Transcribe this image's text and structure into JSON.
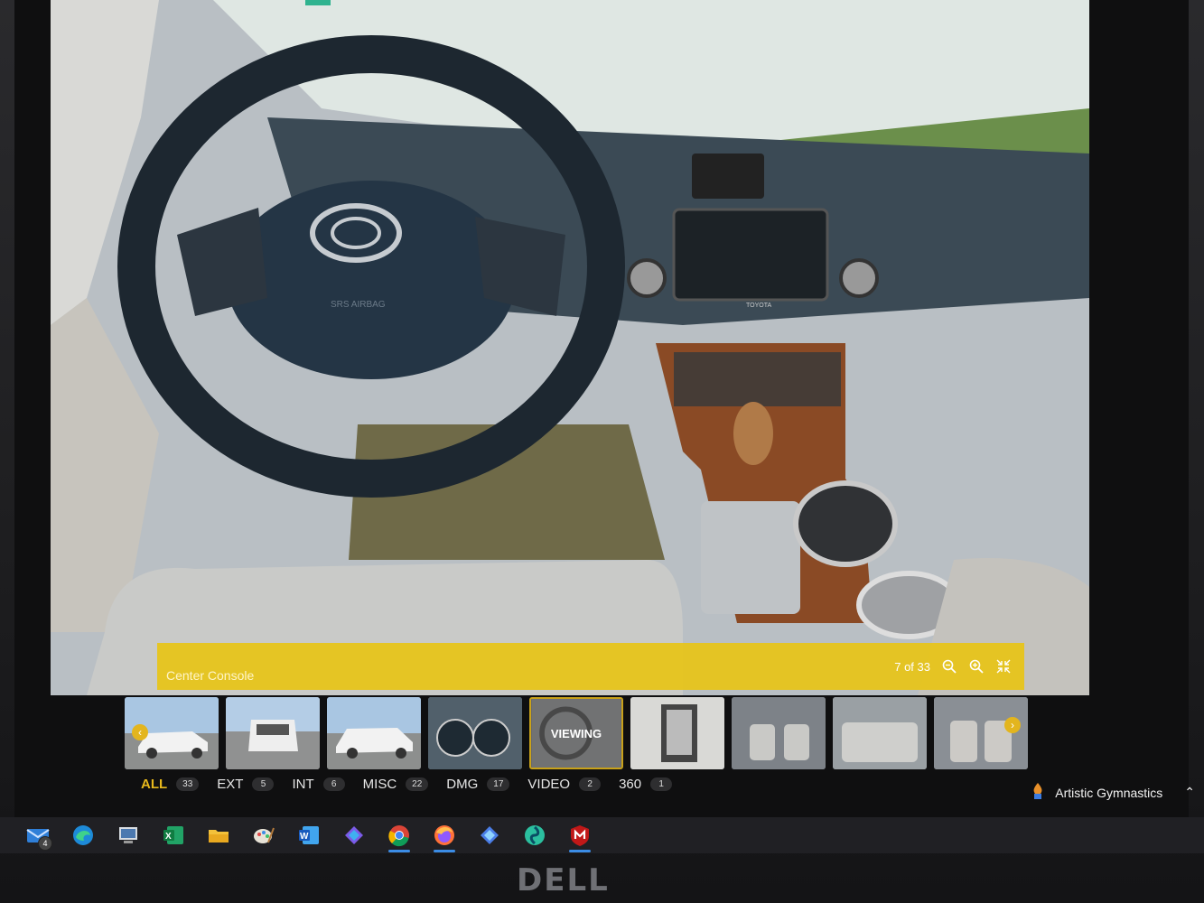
{
  "viewer": {
    "caption": "Center Console",
    "counter": "7 of 33",
    "controls": [
      "zoom-out-icon",
      "zoom-in-icon",
      "collapse-icon"
    ],
    "dash_brand": "TOYOTA",
    "airbag_label": "SRS AIRBAG"
  },
  "thumbnails": [
    {
      "kind": "exterior-side",
      "arrow": "left"
    },
    {
      "kind": "exterior-rear"
    },
    {
      "kind": "exterior-side"
    },
    {
      "kind": "gauge-cluster"
    },
    {
      "kind": "current",
      "label": "VIEWING"
    },
    {
      "kind": "interior-fusebox"
    },
    {
      "kind": "interior-seats"
    },
    {
      "kind": "interior-rear-seats"
    },
    {
      "kind": "interior-seats-2",
      "arrow": "right"
    }
  ],
  "filters": [
    {
      "label": "ALL",
      "count": "33",
      "active": true
    },
    {
      "label": "EXT",
      "count": "5"
    },
    {
      "label": "INT",
      "count": "6"
    },
    {
      "label": "MISC",
      "count": "22"
    },
    {
      "label": "DMG",
      "count": "17"
    },
    {
      "label": "VIDEO",
      "count": "2"
    },
    {
      "label": "360",
      "count": "1"
    }
  ],
  "taskbar": {
    "mail_badge": "4",
    "apps": [
      "mail-icon",
      "edge-icon",
      "file-server-icon",
      "excel-icon",
      "file-explorer-icon",
      "paint-icon",
      "word-icon",
      "copilot-icon",
      "chrome-icon",
      "firefox-icon",
      "copilot-alt-icon",
      "fan-icon",
      "mcafee-icon"
    ],
    "tray_text": "Artistic Gymnastics"
  },
  "monitor_brand": "DELL",
  "colors": {
    "accent": "#e8b91c",
    "caption_bar": "#e7c416",
    "taskbar": "#202024"
  }
}
